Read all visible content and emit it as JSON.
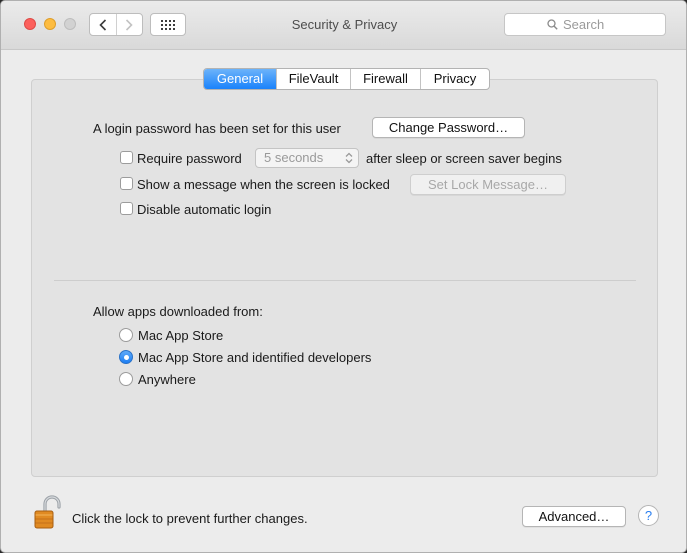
{
  "window": {
    "title": "Security & Privacy"
  },
  "toolbar": {
    "search_placeholder": "Search"
  },
  "tabs": [
    {
      "label": "General",
      "active": true
    },
    {
      "label": "FileVault",
      "active": false
    },
    {
      "label": "Firewall",
      "active": false
    },
    {
      "label": "Privacy",
      "active": false
    }
  ],
  "general": {
    "login_password_text": "A login password has been set for this user",
    "change_password_label": "Change Password…",
    "require_password": {
      "label": "Require password",
      "checked": false,
      "delay_value": "5 seconds",
      "suffix": "after sleep or screen saver begins"
    },
    "show_message": {
      "label": "Show a message when the screen is locked",
      "checked": false,
      "button_label": "Set Lock Message…"
    },
    "disable_auto_login": {
      "label": "Disable automatic login",
      "checked": false
    },
    "allow_apps_label": "Allow apps downloaded from:",
    "allow_apps_options": [
      {
        "label": "Mac App Store",
        "selected": false
      },
      {
        "label": "Mac App Store and identified developers",
        "selected": true
      },
      {
        "label": "Anywhere",
        "selected": false
      }
    ]
  },
  "footer": {
    "lock_text": "Click the lock to prevent further changes.",
    "advanced_label": "Advanced…",
    "help_label": "?"
  },
  "colors": {
    "accent": "#1a82fb",
    "close": "#fc605c",
    "minimize": "#fdbc40",
    "zoom": "#d2d2d2"
  },
  "icons": {
    "back": "chevron-left-icon",
    "forward": "chevron-right-icon",
    "show_all": "grid-icon",
    "search": "magnifier-icon",
    "lock": "open-padlock-icon"
  }
}
